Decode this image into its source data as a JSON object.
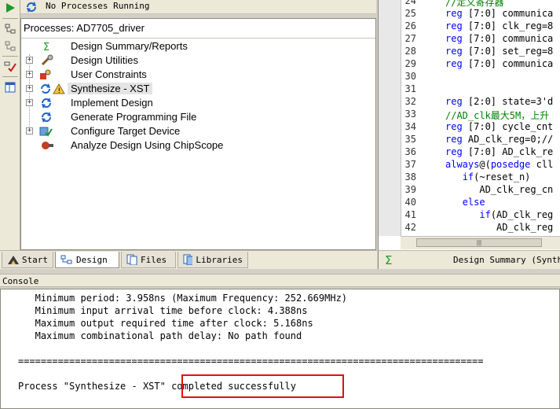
{
  "status": {
    "text": "No Processes Running"
  },
  "processes": {
    "title": "Processes: AD7705_driver",
    "items": [
      {
        "label": "Design Summary/Reports",
        "expandable": false
      },
      {
        "label": "Design Utilities",
        "expandable": true
      },
      {
        "label": "User Constraints",
        "expandable": true
      },
      {
        "label": "Synthesize - XST",
        "expandable": true,
        "selected": true
      },
      {
        "label": "Implement Design",
        "expandable": true
      },
      {
        "label": "Generate Programming File",
        "expandable": false
      },
      {
        "label": "Configure Target Device",
        "expandable": true
      },
      {
        "label": "Analyze Design Using ChipScope",
        "expandable": false
      }
    ]
  },
  "editor": {
    "line_numbers": [
      "24",
      "25",
      "26",
      "27",
      "28",
      "29",
      "30",
      "31",
      "32",
      "33",
      "34",
      "35",
      "36",
      "37",
      "38",
      "39",
      "40",
      "41",
      "42"
    ],
    "lines": [
      "//定义寄存器",
      "reg [7:0] communica",
      "reg [7:0] clk_reg=8",
      "reg [7:0] communica",
      "reg [7:0] set_reg=8",
      "reg [7:0] communica",
      "",
      "",
      "reg [2:0] state=3'd",
      "//AD_clk最大5M，上升",
      "reg [7:0] cycle_cnt",
      "reg AD_clk_reg=0;//",
      "reg [7:0] AD_clk_re",
      "always@(posedge cll",
      "   if(~reset_n)",
      "      AD_clk_reg_cn",
      "   else",
      "      if(AD_clk_reg",
      "         AD_clk_reg"
    ],
    "scroll_grip": "|||"
  },
  "tabs": [
    {
      "label": "Start",
      "icon": "start-icon"
    },
    {
      "label": "Design",
      "icon": "design-icon",
      "active": true
    },
    {
      "label": "Files",
      "icon": "files-icon"
    },
    {
      "label": "Libraries",
      "icon": "libraries-icon"
    }
  ],
  "summary_tab": {
    "label": "Design Summary (Synthes"
  },
  "console": {
    "title": "Console",
    "lines": [
      "   Minimum period: 3.958ns (Maximum Frequency: 252.669MHz)",
      "   Minimum input arrival time before clock: 4.388ns",
      "   Maximum output required time after clock: 5.168ns",
      "   Maximum combinational path delay: No path found",
      "",
      "==================================================================================",
      "",
      "Process \"Synthesize - XST\" completed successfully"
    ]
  },
  "colors": {
    "highlight": "#e01010",
    "keyword": "#0000ff",
    "comment": "#008000"
  }
}
